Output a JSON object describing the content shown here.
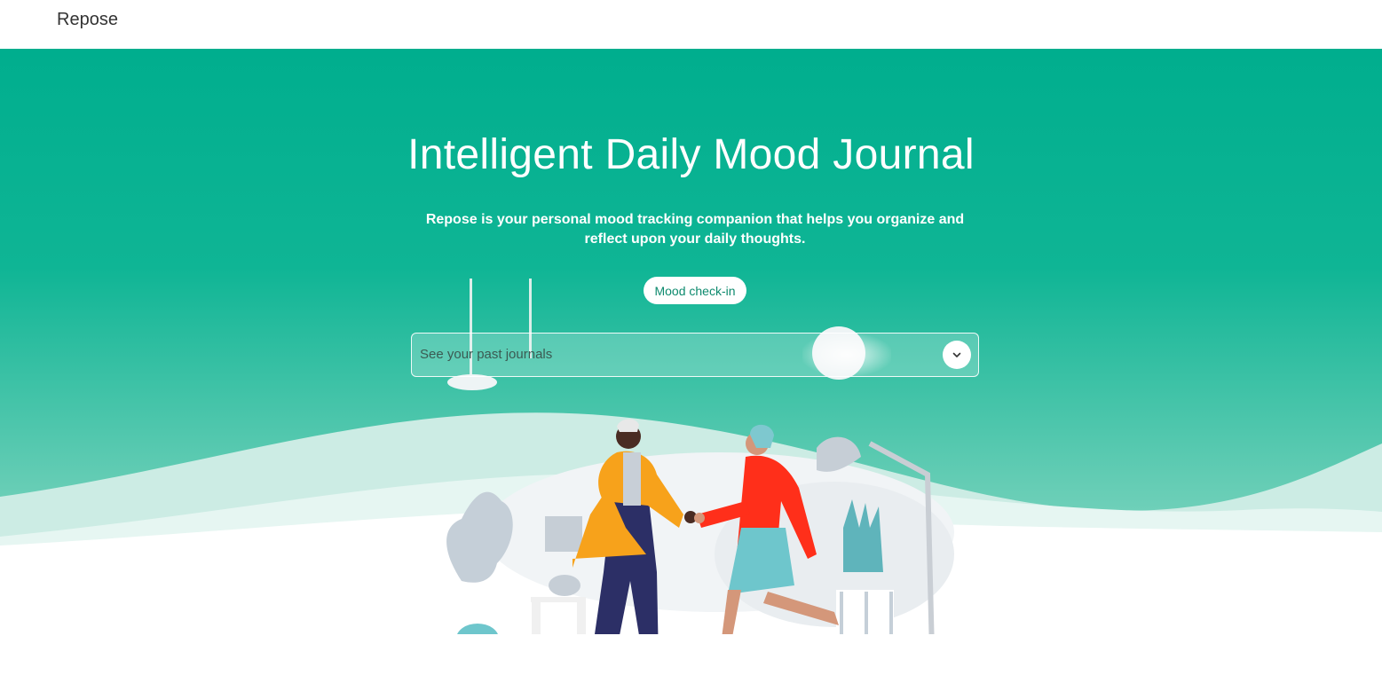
{
  "nav": {
    "brand": "Repose"
  },
  "hero": {
    "title": "Intelligent Daily Mood Journal",
    "subtitle": "Repose is your personal mood tracking companion that helps you organize and reflect upon your daily thoughts.",
    "checkin_button": "Mood check-in",
    "journals_select": {
      "placeholder": "See your past journals",
      "icon": "chevron-down-icon"
    }
  },
  "colors": {
    "brand_green": "#00b08f",
    "button_text": "#0e8a6e",
    "white": "#ffffff"
  }
}
